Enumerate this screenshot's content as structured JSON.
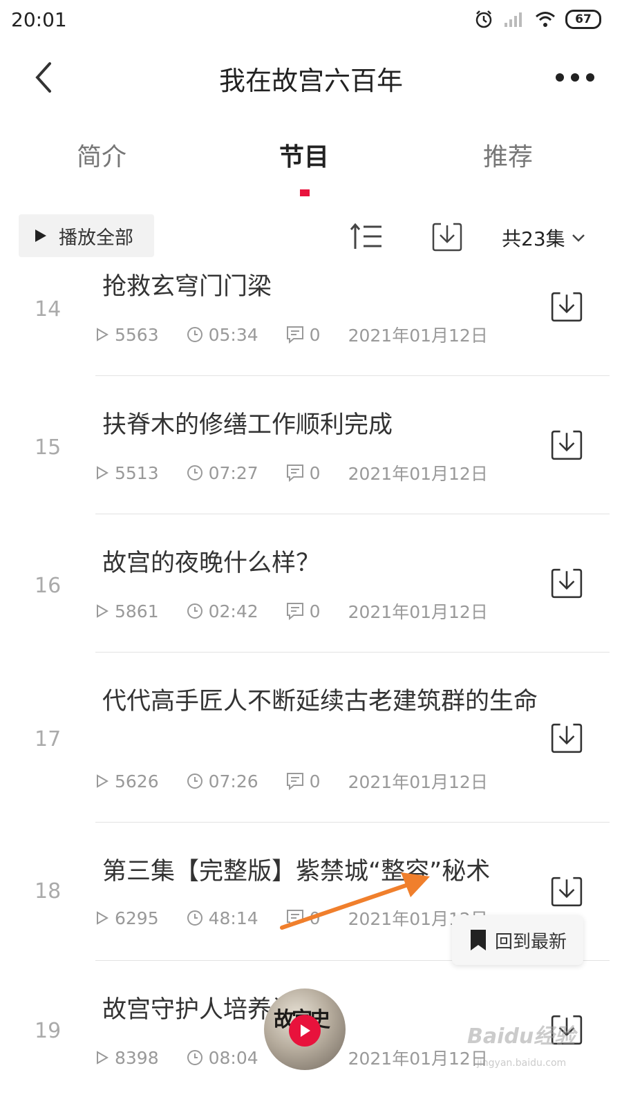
{
  "status_bar": {
    "time": "20:01",
    "battery": "67",
    "icons": [
      "alarm-icon",
      "signal-icon",
      "wifi-icon",
      "battery-icon"
    ]
  },
  "header": {
    "title": "我在故宫六百年",
    "back_icon": "chevron-left-icon",
    "more_icon": "more-dots-icon"
  },
  "tabs": [
    {
      "label": "简介",
      "active": false
    },
    {
      "label": "节目",
      "active": true
    },
    {
      "label": "推荐",
      "active": false
    }
  ],
  "toolbar": {
    "play_all_label": "播放全部",
    "episode_count": "共23集",
    "sort_icon": "sort-order-icon",
    "download_icon": "download-icon"
  },
  "episodes": [
    {
      "num": "14",
      "title": "抢救玄穹门门梁",
      "plays": "5563",
      "duration": "05:34",
      "comments": "0",
      "date": "2021年01月12日"
    },
    {
      "num": "15",
      "title": "扶脊木的修缮工作顺利完成",
      "plays": "5513",
      "duration": "07:27",
      "comments": "0",
      "date": "2021年01月12日"
    },
    {
      "num": "16",
      "title": "故宫的夜晚什么样？",
      "plays": "5861",
      "duration": "02:42",
      "comments": "0",
      "date": "2021年01月12日"
    },
    {
      "num": "17",
      "title": "代代高手匠人不断延续古老建筑群的生命",
      "plays": "5626",
      "duration": "07:26",
      "comments": "0",
      "date": "2021年01月12日"
    },
    {
      "num": "18",
      "title": "第三集【完整版】紫禁城“整容”秘术",
      "plays": "6295",
      "duration": "48:14",
      "comments": "0",
      "date": "2021年01月12日"
    },
    {
      "num": "19",
      "title": "故宫守护人培养计划",
      "plays": "8398",
      "duration": "08:04",
      "comments": "0",
      "date": "2021年01月12日"
    }
  ],
  "back_to_latest_label": "回到最新",
  "mini_player": {
    "cover_text": "故宫史"
  },
  "accent_color": "#e8123c",
  "annotation_color": "#f07f2c",
  "watermark": {
    "main": "Baidu经验",
    "sub": "jingyan.baidu.com"
  }
}
